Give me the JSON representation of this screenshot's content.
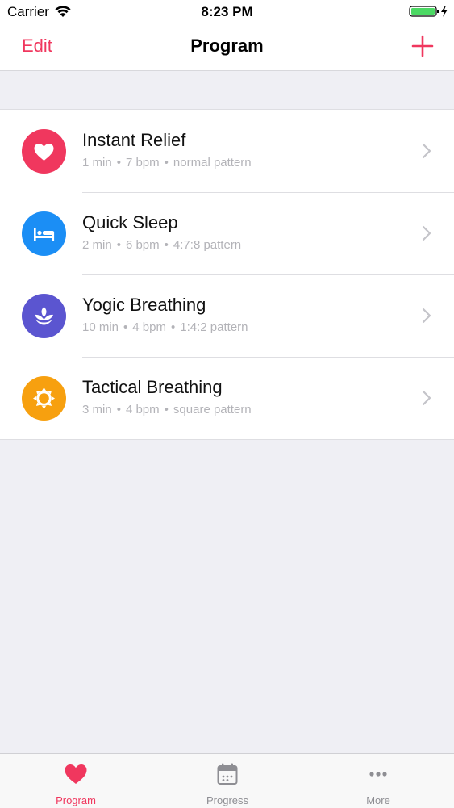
{
  "status_bar": {
    "carrier": "Carrier",
    "time": "8:23 PM"
  },
  "nav": {
    "edit_label": "Edit",
    "title": "Program",
    "add_icon": "plus-icon"
  },
  "programs": [
    {
      "title": "Instant Relief",
      "duration": "1 min",
      "rate": "7 bpm",
      "pattern": "normal pattern",
      "icon": "heart-icon",
      "color": "#f0375e"
    },
    {
      "title": "Quick Sleep",
      "duration": "2 min",
      "rate": "6 bpm",
      "pattern": "4:7:8 pattern",
      "icon": "bed-icon",
      "color": "#1b8ef5"
    },
    {
      "title": "Yogic Breathing",
      "duration": "10 min",
      "rate": "4 bpm",
      "pattern": "1:4:2 pattern",
      "icon": "lotus-icon",
      "color": "#5b55d0"
    },
    {
      "title": "Tactical Breathing",
      "duration": "3 min",
      "rate": "4 bpm",
      "pattern": "square pattern",
      "icon": "sun-icon",
      "color": "#f7a00f"
    }
  ],
  "tabs": [
    {
      "label": "Program",
      "icon": "heart-icon",
      "active": true
    },
    {
      "label": "Progress",
      "icon": "calendar-icon",
      "active": false
    },
    {
      "label": "More",
      "icon": "more-icon",
      "active": false
    }
  ],
  "colors": {
    "accent": "#f0375e",
    "inactive_tab": "#8e8e93",
    "subtitle": "#b3b3b8",
    "background": "#efeff4"
  }
}
